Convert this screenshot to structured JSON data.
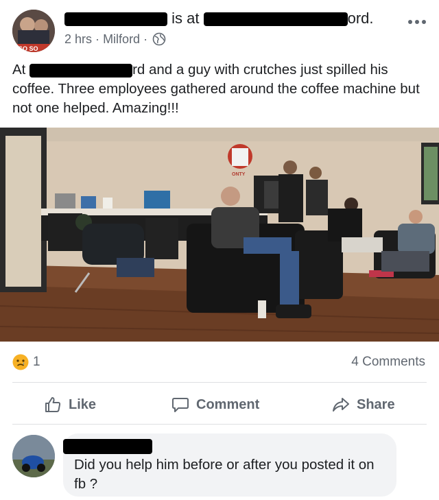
{
  "post": {
    "author_suffix": "is at",
    "place_suffix": "ord.",
    "time": "2 hrs",
    "separator": "·",
    "location": "Milford",
    "privacy_icon": "globe-icon",
    "text_start": "At",
    "text_rest": "rd and a guy with crutches just spilled his coffee.  Three employees gathered around the coffee machine but not one helped.  Amazing!!!"
  },
  "avatar_badge": "GO SO",
  "photo_sign": "ONTY",
  "reactions": {
    "emoji": "sad-face-icon",
    "count": "1",
    "comments": "4 Comments"
  },
  "actions": {
    "like": "Like",
    "comment": "Comment",
    "share": "Share"
  },
  "comment": {
    "text": "Did you help him before or after you posted it on fb  ?"
  },
  "colors": {
    "text_primary": "#1c1e21",
    "text_secondary": "#606770",
    "divider": "#dddfe2",
    "comment_bg": "#f2f3f5",
    "reaction_yellow": "#f7b125"
  }
}
